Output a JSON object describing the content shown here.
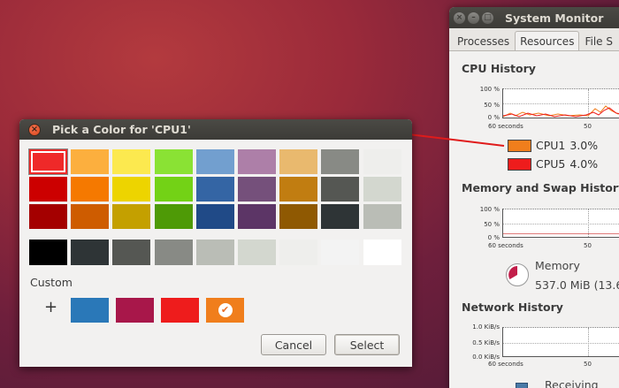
{
  "system_monitor": {
    "title": "System Monitor",
    "tabs": [
      "Processes",
      "Resources",
      "File S"
    ],
    "active_tab": "Resources",
    "cpu": {
      "heading": "CPU History",
      "y_ticks": [
        "100 %",
        "50 %",
        "0 %"
      ],
      "x_ticks": [
        "60 seconds",
        "50"
      ],
      "legend": [
        {
          "label": "CPU1",
          "value": "3.0%",
          "color": "#f07e1c"
        },
        {
          "label": "CPU5",
          "value": "4.0%",
          "color": "#ee1c1c"
        }
      ]
    },
    "memory": {
      "heading": "Memory and Swap History",
      "y_ticks": [
        "100 %",
        "50 %",
        "0 %"
      ],
      "x_ticks": [
        "60 seconds",
        "50"
      ],
      "label": "Memory",
      "value": "537.0 MiB (13.6"
    },
    "network": {
      "heading": "Network History",
      "y_ticks": [
        "1.0 KiB/s",
        "0.5 KiB/s",
        "0.0 KiB/s"
      ],
      "x_ticks": [
        "60 seconds",
        "50"
      ],
      "receiving_label": "Receiving"
    }
  },
  "dialog": {
    "title": "Pick a Color for 'CPU1'",
    "close_icon": "close-icon",
    "palette_rows": [
      [
        "#ef2929",
        "#fcaf3e",
        "#fce94f",
        "#8ae234",
        "#729fcf",
        "#ad7fa8",
        "#e9b96e",
        "#888a85",
        "#eeeeec"
      ],
      [
        "#cc0000",
        "#f57900",
        "#edd400",
        "#73d216",
        "#3465a4",
        "#75507b",
        "#c17d11",
        "#555753",
        "#d3d7cf"
      ],
      [
        "#a40000",
        "#ce5c00",
        "#c4a000",
        "#4e9a06",
        "#204a87",
        "#5c3566",
        "#8f5902",
        "#2e3436",
        "#babdb6"
      ]
    ],
    "selected_color": "#ef2929",
    "grays": [
      "#000000",
      "#2e3436",
      "#555753",
      "#888a85",
      "#babdb6",
      "#d3d7cf",
      "#eeeeec",
      "#f3f3f3",
      "#ffffff"
    ],
    "custom_label": "Custom",
    "add_custom": "+",
    "custom_colors": [
      "#2a78b8",
      "#a8174a",
      "#ee1c1c",
      "#f07e1c"
    ],
    "custom_selected_index": 3,
    "cancel_label": "Cancel",
    "select_label": "Select"
  }
}
